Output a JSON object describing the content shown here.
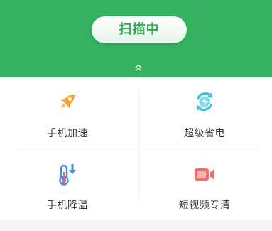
{
  "header": {
    "scan_button_label": "扫描中",
    "expand_icon": "double-chevron-up-icon",
    "background_color": "#34b260"
  },
  "tools": [
    {
      "label": "手机加速",
      "icon": "rocket-icon",
      "color": "#f6a52a"
    },
    {
      "label": "超级省电",
      "icon": "battery-saver-icon",
      "color": "#36c2d8"
    },
    {
      "label": "手机降温",
      "icon": "thermometer-down-icon",
      "color": "#3a8de8"
    },
    {
      "label": "短视频专清",
      "icon": "video-camera-icon",
      "color": "#f26b6b"
    }
  ]
}
